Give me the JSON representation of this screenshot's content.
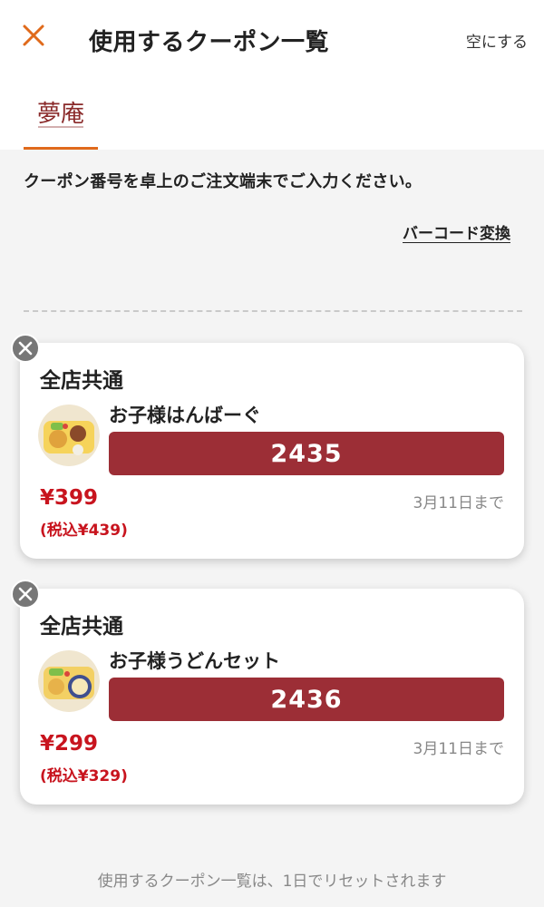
{
  "header": {
    "title": "使用するクーポン一覧",
    "clear_label": "空にする",
    "close_icon": "close-icon"
  },
  "brand_tab": {
    "logo_text": "夢庵",
    "accent_color": "#e06a1b"
  },
  "instruction": "クーポン番号を卓上のご注文端末でご入力ください。",
  "barcode_label": "バーコード変換",
  "coupons": [
    {
      "scope": "全店共通",
      "item_name": "お子様はんばーぐ",
      "code": "2435",
      "price": "¥399",
      "price_tax": "(税込¥439)",
      "expiry": "3月11日まで"
    },
    {
      "scope": "全店共通",
      "item_name": "お子様うどんセット",
      "code": "2436",
      "price": "¥299",
      "price_tax": "(税込¥329)",
      "expiry": "3月11日まで"
    }
  ],
  "footer_note": "使用するクーポン一覧は、1日でリセットされます",
  "colors": {
    "code_bar": "#9c2e36",
    "price": "#c8141e",
    "remove_button": "#777777"
  }
}
